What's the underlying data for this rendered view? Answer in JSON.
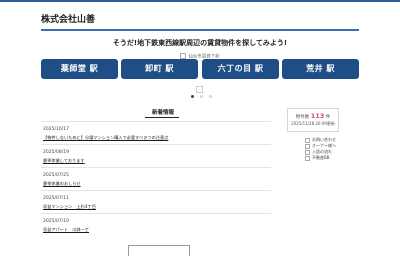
{
  "header": {
    "company": "株式会社山善"
  },
  "hero": {
    "tagline": "そうだ!地下鉄東西線駅周辺の賃貸物件を探してみよう!",
    "banner_alt": "仙台市賃貸下新"
  },
  "stations": [
    {
      "label": "薬師堂 駅"
    },
    {
      "label": "卸町 駅"
    },
    {
      "label": "六丁の目 駅"
    },
    {
      "label": "荒井 駅"
    }
  ],
  "carousel": {
    "slide_count": 3,
    "active_index": 0
  },
  "news": {
    "title": "新着情報",
    "items": [
      {
        "date": "2025/10/17",
        "text": "【物件しないために】分譲マンション購入で必要すべきつの注意点"
      },
      {
        "date": "2025/08/19",
        "text": "夏季休業しております"
      },
      {
        "date": "2025/07/25",
        "text": "夏季休業のおしらせ"
      },
      {
        "date": "2025/07/11",
        "text": "収益マンション　上杉4丁目"
      },
      {
        "date": "2025/07/10",
        "text": "収益アパート　川鉢一丁"
      }
    ]
  },
  "stats": {
    "label": "物件数",
    "count": "113",
    "unit": "件",
    "updated": "2025/11/28 20:09更新"
  },
  "sidebar": {
    "links": [
      {
        "text": "お問い合わせ"
      },
      {
        "text": "オーナー様へ"
      },
      {
        "text": "入居の流れ"
      },
      {
        "text": "不動産BB"
      }
    ]
  }
}
